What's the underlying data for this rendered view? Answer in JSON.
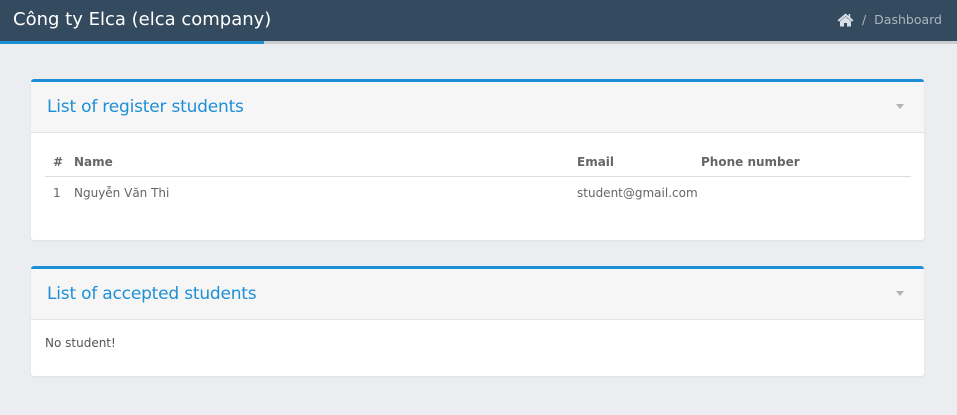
{
  "header": {
    "title": "Công ty Elca (elca company)",
    "breadcrumb": {
      "home_icon": "home-icon",
      "separator": "/",
      "current": "Dashboard"
    }
  },
  "colors": {
    "header_bg": "#344a5f",
    "accent": "#1d8fd6",
    "page_bg": "#ebedf0"
  },
  "register_panel": {
    "title": "List of register students",
    "toggle_icon": "caret-down-icon",
    "columns": [
      "#",
      "Name",
      "Email",
      "Phone number"
    ],
    "rows": [
      {
        "num": "1",
        "name": "Nguyễn Văn Thi",
        "email": "student@gmail.com",
        "phone": ""
      }
    ]
  },
  "accepted_panel": {
    "title": "List of accepted students",
    "toggle_icon": "caret-down-icon",
    "empty_text": "No student!"
  }
}
